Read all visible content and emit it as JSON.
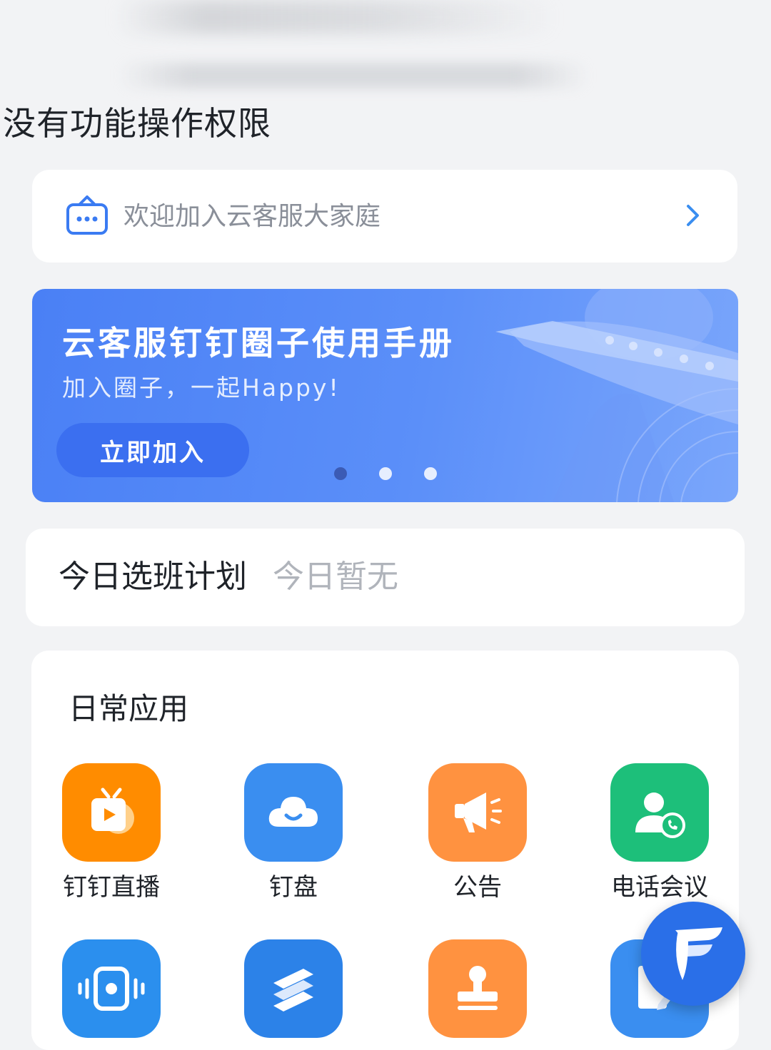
{
  "header": {
    "no_permission": "没有功能操作权限"
  },
  "welcome": {
    "text": "欢迎加入云客服大家庭",
    "icon": "chat-bot-icon"
  },
  "banner": {
    "title": "云客服钉钉圈子使用手册",
    "subtitle": "加入圈子，一起Happy!",
    "button_label": "立即加入",
    "slide_count": 3,
    "active_slide": 1
  },
  "plan": {
    "title": "今日选班计划",
    "value": "今日暂无"
  },
  "apps": {
    "title": "日常应用",
    "items": [
      {
        "label": "钉钉直播",
        "icon": "live-tv-icon",
        "color": "#ff8c00"
      },
      {
        "label": "钉盘",
        "icon": "cloud-smile-icon",
        "color": "#3a8ef0"
      },
      {
        "label": "公告",
        "icon": "megaphone-icon",
        "color": "#ff9240"
      },
      {
        "label": "电话会议",
        "icon": "contact-phone-icon",
        "color": "#1dbf7a"
      },
      {
        "label": "",
        "icon": "vibrate-device-icon",
        "color": "#2b8fee"
      },
      {
        "label": "",
        "icon": "stack-logo-icon",
        "color": "#2c82e8"
      },
      {
        "label": "",
        "icon": "stamp-icon",
        "color": "#ff9240"
      },
      {
        "label": "",
        "icon": "document-pen-icon",
        "color": "#3a8ef0"
      }
    ]
  },
  "colors": {
    "background": "#f2f3f5",
    "accent": "#3b6ff0",
    "muted_text": "#8a8f99"
  }
}
